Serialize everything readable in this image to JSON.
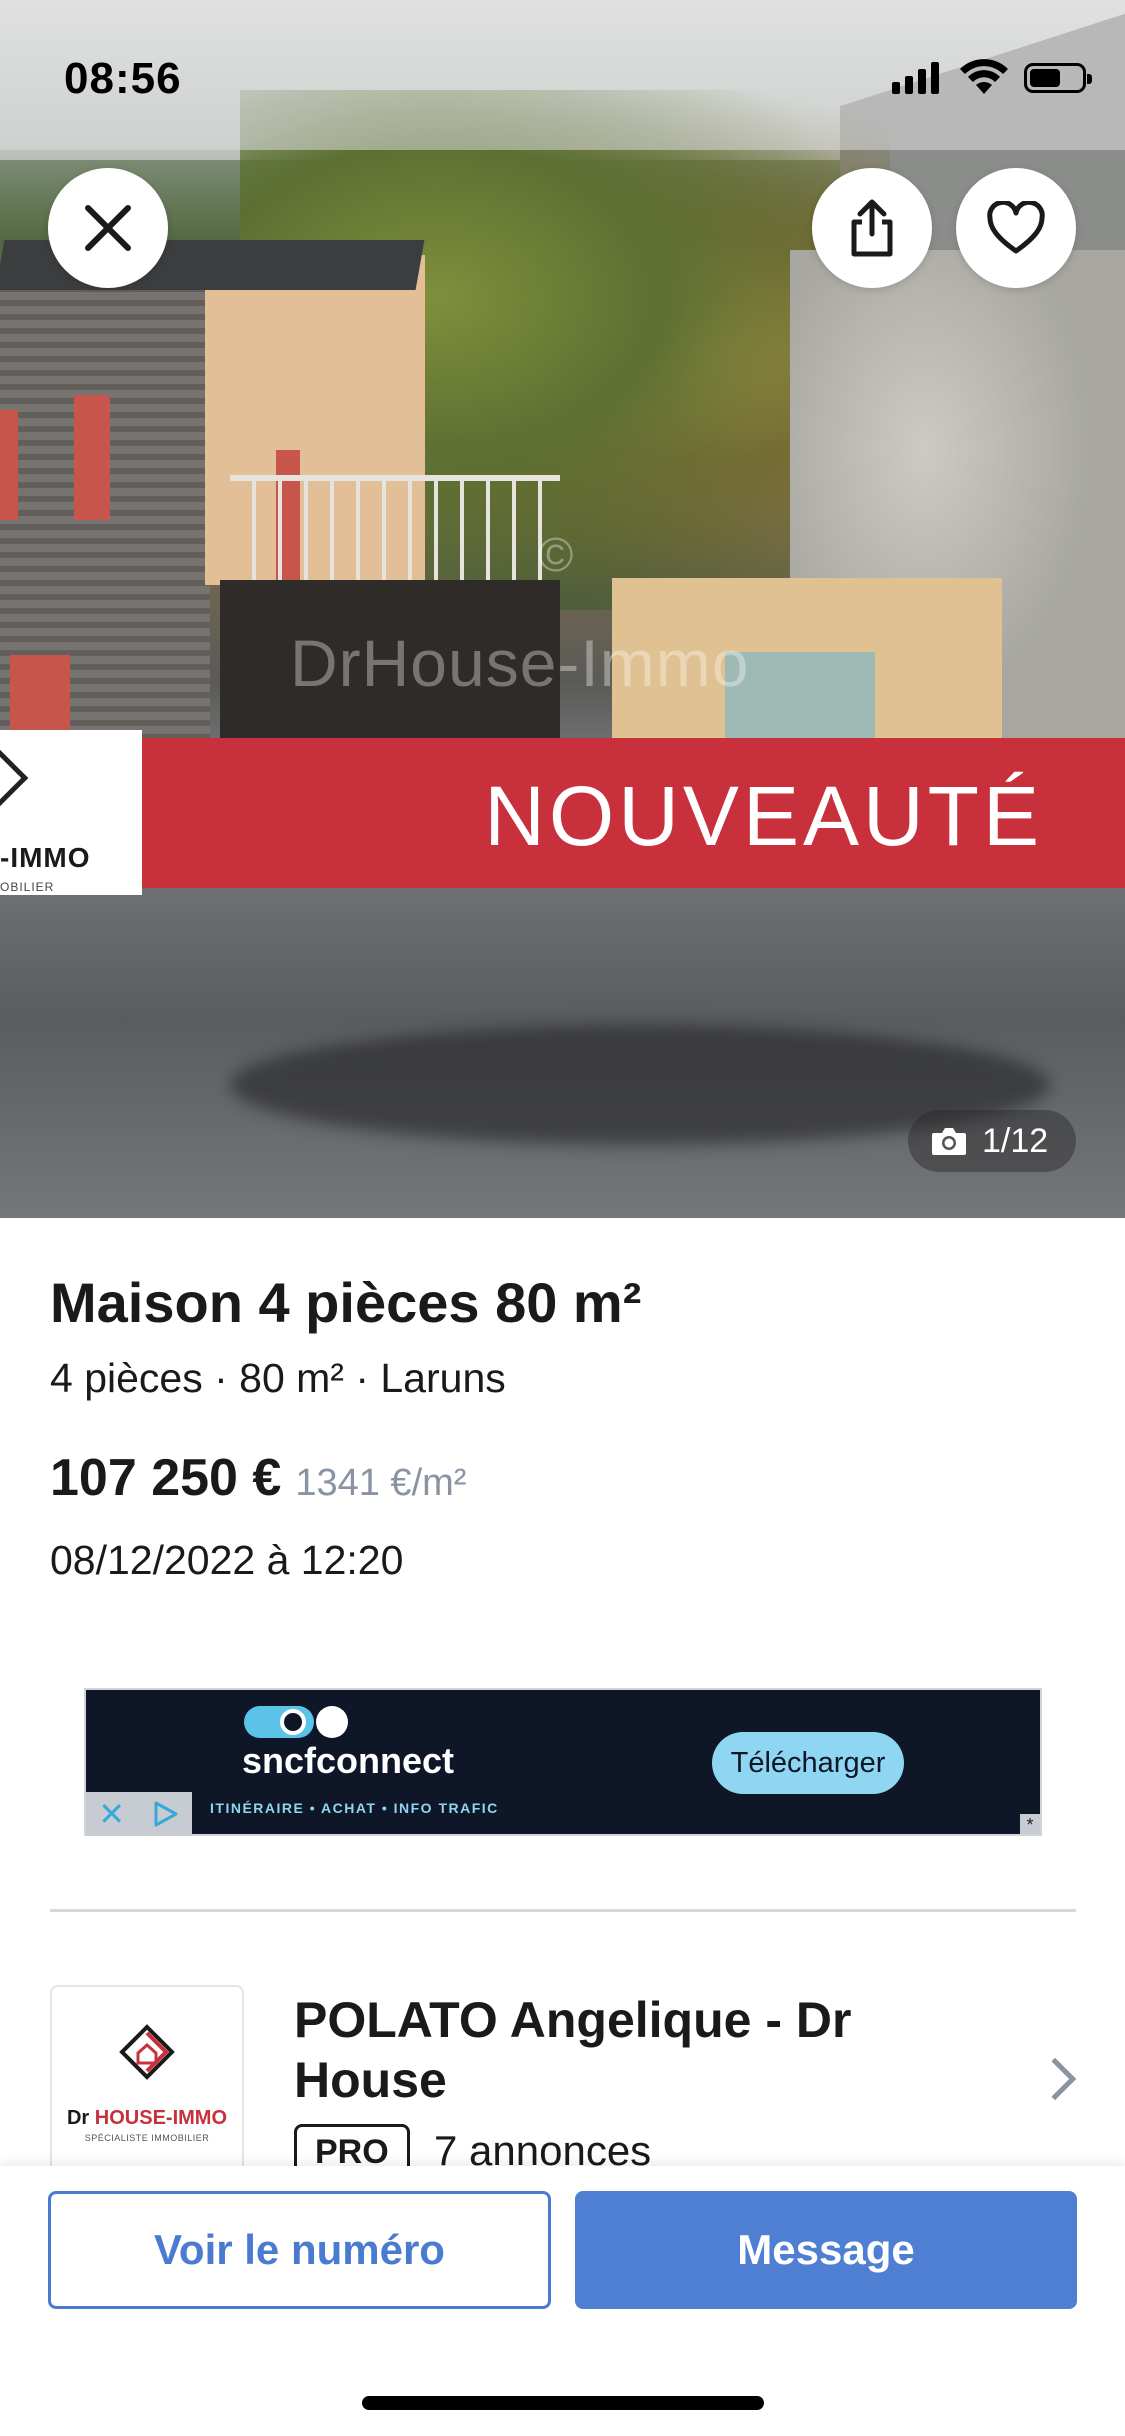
{
  "status_bar": {
    "time": "08:56"
  },
  "photo": {
    "banner_text": "NOUVEAUTÉ",
    "watermark": "DrHouse-Immo",
    "watermark_symbol": "©",
    "logo_text": "-IMMO",
    "logo_subtext": "OBILIER",
    "counter": "1/12",
    "icons": {
      "close": "close-icon",
      "share": "share-icon",
      "favorite": "heart-icon",
      "camera": "camera-icon"
    }
  },
  "listing": {
    "title": "Maison 4 pièces 80 m²",
    "subtitle": "4 pièces · 80 m² · Laruns",
    "price": "107 250 €",
    "price_per_m2": "1341 €/m²",
    "date": "08/12/2022 à 12:20"
  },
  "ad": {
    "brand": "sncfconnect",
    "tagline": "ITINÉRAIRE • ACHAT • INFO TRAFIC",
    "cta": "Télécharger",
    "adchoice_close": "✕",
    "corner_mark": "*"
  },
  "seller": {
    "logo_prefix": "Dr ",
    "logo_name": "HOUSE-IMMO",
    "logo_sub": "SPÉCIALISTE IMMOBILIER",
    "name": "POLATO Angelique - Dr House",
    "badge": "PRO",
    "listings": "7 annonces"
  },
  "actions": {
    "call_label": "Voir le numéro",
    "message_label": "Message"
  },
  "colors": {
    "accent": "#4f7fd3",
    "banner_red": "#c8303c",
    "muted": "#8a93a3"
  }
}
